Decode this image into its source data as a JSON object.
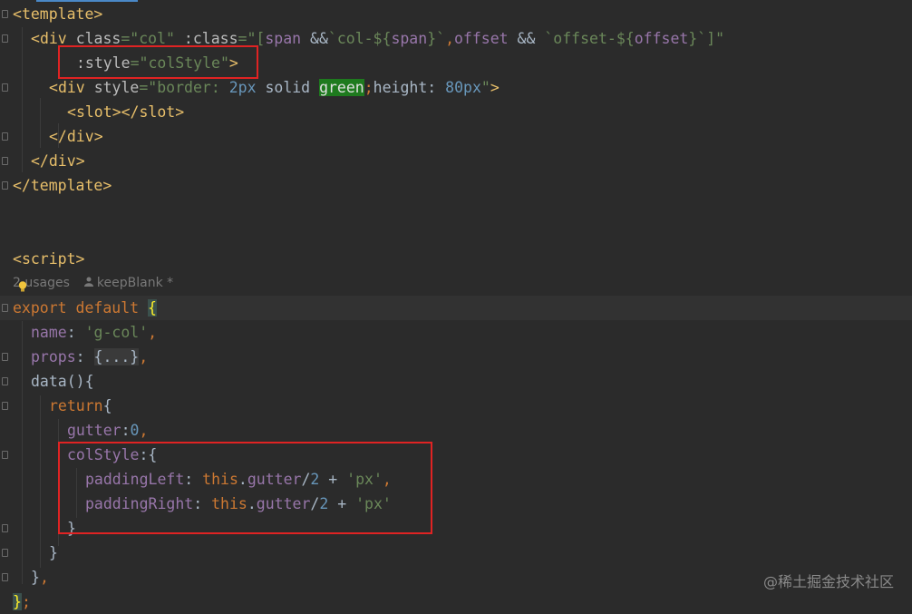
{
  "editor": {
    "lines": {
      "l1": {
        "open": "<",
        "tag": "template",
        "close": ">"
      },
      "l2": {
        "a": "<",
        "tag": "div",
        "b": " ",
        "attr1": "class",
        "eq1": "=",
        "val1": "\"col\"",
        "c": " ",
        "attr2": ":class",
        "eq2": "=",
        "val2a": "\"[",
        "span1": "span",
        "amp1": " &&",
        "tpl1a": "`col-${",
        "span2": "span",
        "tpl1b": "}`",
        "comma": ",",
        "offset1": "offset",
        "amp2": " && ",
        "tpl2a": "`offset-${",
        "offset2": "offset",
        "tpl2b": "}`",
        "val2b": "]\""
      },
      "l3": {
        "attr": ":style",
        "eq": "=",
        "val": "\"colStyle\"",
        "close": ">"
      },
      "l4": {
        "a": "<",
        "tag": "div",
        "b": " ",
        "attr": "style",
        "eq": "=",
        "q1": "\"border: ",
        "n1": "2px",
        "s1": " solid ",
        "green": "green",
        "semi": ";",
        "s2": "height: ",
        "n2": "80px",
        "q2": "\"",
        "close": ">"
      },
      "l5": {
        "a": "<",
        "tag1": "slot",
        "b": "></",
        "tag2": "slot",
        "c": ">"
      },
      "l6": {
        "a": "</",
        "tag": "div",
        "b": ">"
      },
      "l7": {
        "a": "</",
        "tag": "div",
        "b": ">"
      },
      "l8": {
        "a": "</",
        "tag": "template",
        "b": ">"
      },
      "l11": {
        "a": "<",
        "tag": "script",
        "b": ">"
      },
      "l13": {
        "kw": "export default ",
        "brace": "{"
      },
      "l14": {
        "prop": "name",
        "colon": ": ",
        "str": "'g-col'",
        "comma": ","
      },
      "l15": {
        "prop": "props",
        "colon": ": ",
        "ph": "{...}",
        "comma": ","
      },
      "l16": {
        "fn": "data(){"
      },
      "l17": {
        "kw": "return",
        "brace": "{"
      },
      "l18": {
        "prop": "gutter",
        "colon": ":",
        "num": "0",
        "comma": ","
      },
      "l19": {
        "prop": "colStyle",
        "rest": ":{"
      },
      "l20": {
        "prop": "paddingLeft",
        "colon": ": ",
        "kw": "this",
        "dot": ".",
        "p2": "gutter",
        "op": "/",
        "num": "2",
        "plus": " + ",
        "str": "'px'",
        "comma": ","
      },
      "l21": {
        "prop": "paddingRight",
        "colon": ": ",
        "kw": "this",
        "dot": ".",
        "p2": "gutter",
        "op": "/",
        "num": "2",
        "plus": " + ",
        "str": "'px'"
      },
      "l22": {
        "brace": "}"
      },
      "l23": {
        "brace": "}"
      },
      "l24": {
        "brace": "}",
        "comma": ","
      },
      "l25": {
        "brace": "}",
        "semi": ";"
      }
    },
    "inlay": {
      "usages": "2 usages",
      "author": "keepBlank *"
    }
  },
  "watermark": "@稀土掘金技术社区"
}
